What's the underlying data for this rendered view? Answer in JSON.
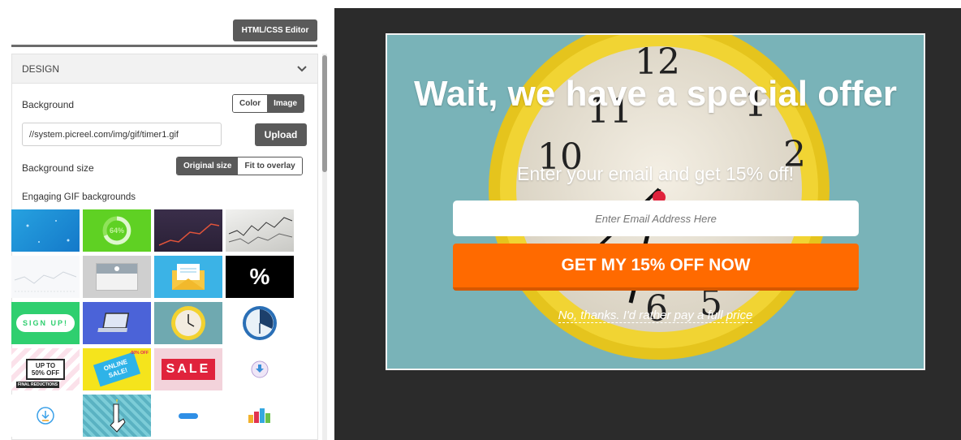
{
  "toolbar": {
    "editor_label": "HTML/CSS Editor"
  },
  "panel": {
    "title": "DESIGN",
    "background_label": "Background",
    "bg_type": {
      "options": [
        "Color",
        "Image"
      ],
      "selected": "Image"
    },
    "url_value": "//system.picreel.com/img/gif/timer1.gif",
    "upload_label": "Upload",
    "bg_size_label": "Background size",
    "bg_size": {
      "options": [
        "Original size",
        "Fit to overlay"
      ],
      "selected": "Original size"
    },
    "gif_label": "Engaging GIF backgrounds",
    "gif_tiles": [
      {
        "name": "blue-particles",
        "text": ""
      },
      {
        "name": "green-progress",
        "text": "64%"
      },
      {
        "name": "dark-chart",
        "text": ""
      },
      {
        "name": "stock-paper",
        "text": ""
      },
      {
        "name": "line-chart-light",
        "text": ""
      },
      {
        "name": "map-pin",
        "text": ""
      },
      {
        "name": "envelope",
        "text": ""
      },
      {
        "name": "percent-black",
        "text": "%"
      },
      {
        "name": "sign-up",
        "text": "SIGN UP!"
      },
      {
        "name": "laptop",
        "text": ""
      },
      {
        "name": "yellow-clock",
        "text": ""
      },
      {
        "name": "blue-clock",
        "text": ""
      },
      {
        "name": "sale-50",
        "text": "UP TO 50% OFF"
      },
      {
        "name": "online-sale",
        "text": "ONLINE SALE!"
      },
      {
        "name": "sale-red",
        "text": "SALE"
      },
      {
        "name": "download-circle",
        "text": ""
      },
      {
        "name": "download-icon",
        "text": ""
      },
      {
        "name": "click-hand",
        "text": ""
      },
      {
        "name": "blue-button",
        "text": ""
      },
      {
        "name": "gifts",
        "text": ""
      }
    ],
    "small_texts": {
      "final_reductions": "FINAL REDUCTIONS",
      "sale_off": "-50% OFF"
    }
  },
  "preview": {
    "headline": "Wait, we have a special offer",
    "subtitle": "Enter your email and get 15% off!",
    "email_placeholder": "Enter Email Address Here",
    "cta_label": "GET MY 15% OFF NOW",
    "decline_label": "No, thanks. I'd rather pay a full price"
  },
  "colors": {
    "cta": "#ff6a00",
    "overlay_bg": "#7bb5ba",
    "dark_button": "#5a5a5a",
    "preview_bg": "#2b2b2b"
  }
}
